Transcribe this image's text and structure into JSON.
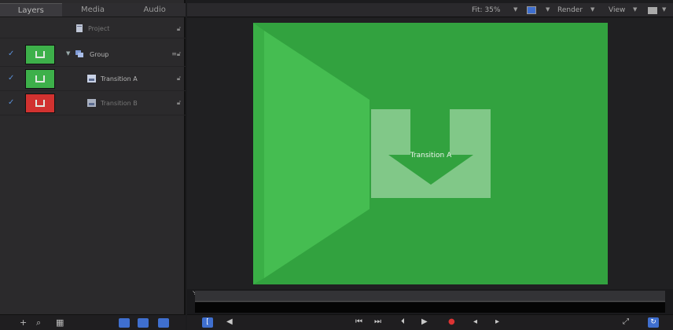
{
  "tabs": [
    {
      "label": "Layers"
    },
    {
      "label": "Media"
    },
    {
      "label": "Audio"
    }
  ],
  "layers": {
    "project": {
      "label": "Project"
    },
    "group": {
      "label": "Group"
    },
    "transition_a": {
      "label": "Transition A"
    },
    "transition_b": {
      "label": "Transition B"
    }
  },
  "topbar": {
    "fit": "Fit: 35%",
    "render": "Render",
    "view": "View"
  },
  "canvas": {
    "logo_label": "Transition A"
  },
  "colors": {
    "canvas_green": "#32a23f",
    "thumb_green": "#3db04a",
    "thumb_red": "#d13230",
    "accent_blue": "#3f6fcf"
  }
}
